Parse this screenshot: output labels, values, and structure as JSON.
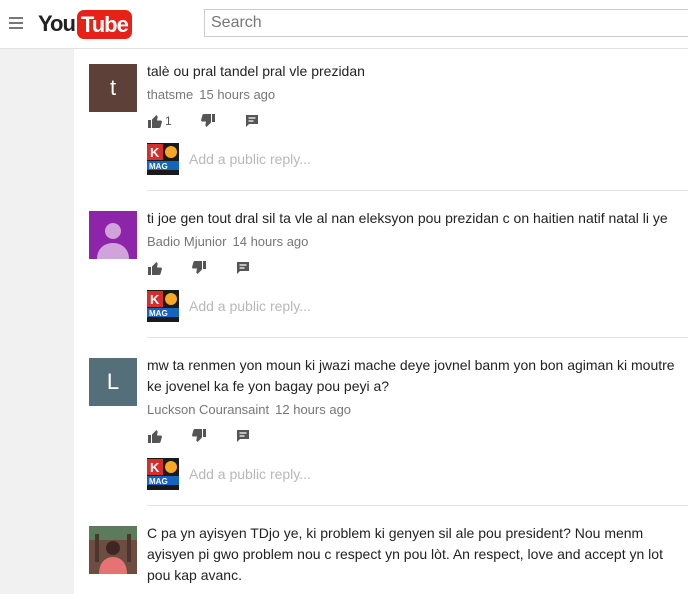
{
  "header": {
    "logo_you": "You",
    "logo_tube": "Tube",
    "search_placeholder": "Search"
  },
  "reply_placeholder": "Add a public reply...",
  "reply_avatar_text": "KC MAG",
  "comments": [
    {
      "avatar_letter": "t",
      "avatar_color": "#5d4037",
      "text": "talè ou pral tandel pral vle prezidan",
      "author": "thatsme",
      "time": "15 hours ago",
      "like_count": "1"
    },
    {
      "avatar_letter": "",
      "avatar_color": "#8e24aa",
      "text": "ti joe gen tout dral sil ta vle al nan eleksyon pou prezidan c on haitien natif natal li ye",
      "author": "Badio Mjunior",
      "time": "14 hours ago",
      "like_count": ""
    },
    {
      "avatar_letter": "L",
      "avatar_color": "#546e7a",
      "text": "mw ta renmen yon moun ki jwazi mache deye jovnel banm yon bon agiman ki moutre ke jovenel ka fe yon bagay pou peyi a?",
      "author": "Luckson Couransaint",
      "time": "12 hours ago",
      "like_count": ""
    },
    {
      "avatar_letter": "",
      "avatar_color": "#8d6e63",
      "text": "C pa yn ayisyen TDjo ye, ki problem ki genyen sil ale pou president? Nou menm ayisyen pi gwo problem nou c respect yn pou lòt. An respect, love and accept yn lot pou kap avanc.",
      "author": "",
      "time": "",
      "like_count": ""
    }
  ]
}
